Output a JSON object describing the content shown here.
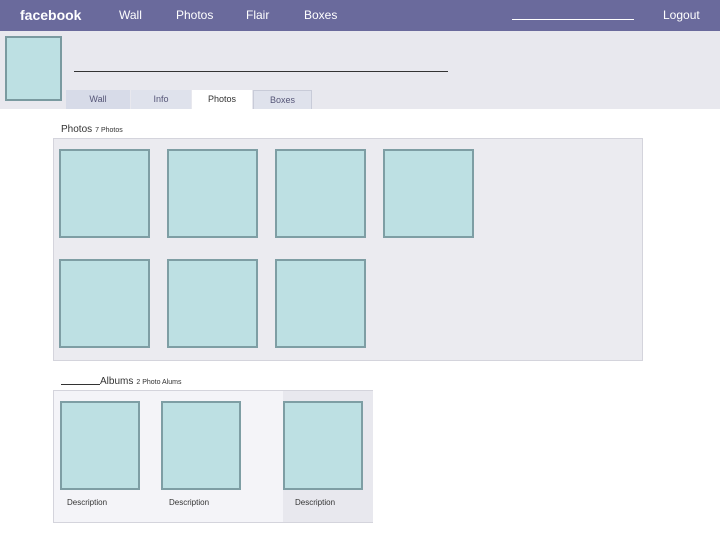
{
  "topbar": {
    "logo": "facebook",
    "nav": [
      "Wall",
      "Photos",
      "Flair",
      "Boxes"
    ],
    "logout": "Logout"
  },
  "profile": {
    "tabs": [
      "Wall",
      "Info",
      "Photos",
      "Boxes"
    ],
    "active_tab": "Photos"
  },
  "photos": {
    "title": "Photos",
    "count": "7 Photos",
    "thumbnail_count": 7
  },
  "albums": {
    "title": "Albums",
    "count": "2 Photo Alums",
    "items": [
      {
        "description": "Description"
      },
      {
        "description": "Description"
      },
      {
        "description": "Description"
      }
    ]
  },
  "colors": {
    "topbar": "#6a6a9c",
    "placeholder_fill": "#bde0e3",
    "placeholder_border": "#7e9ea4",
    "panel": "#ebebf0"
  }
}
